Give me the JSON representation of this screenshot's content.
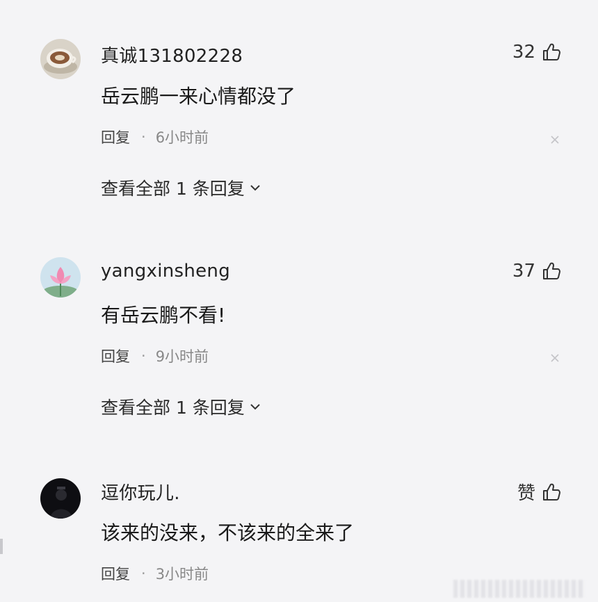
{
  "comments": [
    {
      "username": "真诚131802228",
      "likes": "32",
      "content": "岳云鹏一来心情都没了",
      "reply_label": "回复",
      "separator": "·",
      "time": "6小时前",
      "view_replies": "查看全部 1 条回复",
      "avatar_icon": "coffee-cup-avatar"
    },
    {
      "username": "yangxinsheng",
      "likes": "37",
      "content": "有岳云鹏不看!",
      "reply_label": "回复",
      "separator": "·",
      "time": "9小时前",
      "view_replies": "查看全部 1 条回复",
      "avatar_icon": "lotus-avatar"
    },
    {
      "username": "逗你玩儿.",
      "likes": "赞",
      "content": "该来的没来，不该来的全来了",
      "reply_label": "回复",
      "separator": "·",
      "time": "3小时前",
      "avatar_icon": "dark-photo-avatar"
    }
  ],
  "colors": {
    "background": "#f4f4f6",
    "text": "#1a1a1a",
    "muted": "#888888"
  }
}
